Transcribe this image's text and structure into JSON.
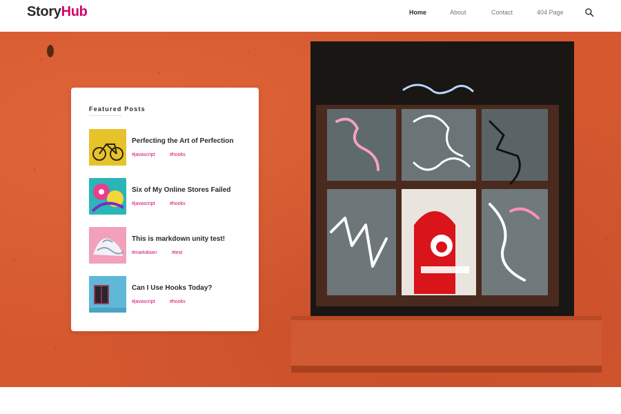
{
  "header": {
    "logo_part1": "Story",
    "logo_part2": "Hub",
    "nav": [
      {
        "label": "Home",
        "active": true
      },
      {
        "label": "About",
        "active": false
      },
      {
        "label": "Contact",
        "active": false
      },
      {
        "label": "404 Page",
        "active": false
      }
    ],
    "search_icon": "search-icon"
  },
  "featured": {
    "title": "Featured Posts",
    "posts": [
      {
        "title": "Perfecting the Art of Perfection",
        "tags": [
          "#javascript",
          "#hooks"
        ],
        "thumb": "yellow-bicycle"
      },
      {
        "title": "Six of My Online Stores Failed",
        "tags": [
          "#javascript",
          "#hooks"
        ],
        "thumb": "colorful-graffiti"
      },
      {
        "title": "This is markdown unity test!",
        "tags": [
          "#markdown",
          "#test"
        ],
        "thumb": "pink-white-mural"
      },
      {
        "title": "Can I Use Hooks Today?",
        "tags": [
          "#javascript",
          "#hooks"
        ],
        "thumb": "blue-wall-window"
      }
    ]
  },
  "colors": {
    "brand": "#d10068",
    "hero_wall": "#d5582f",
    "text": "#292929"
  },
  "hero_image": "orange-wall-graffiti-window"
}
